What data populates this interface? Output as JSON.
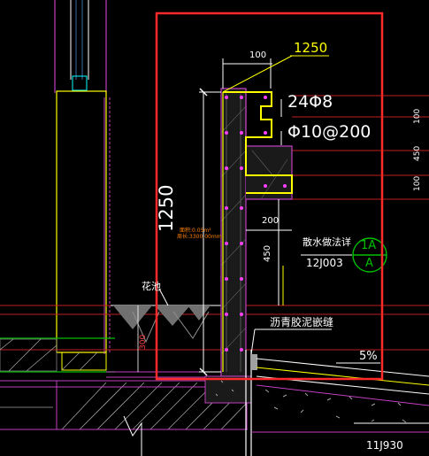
{
  "drawing": {
    "dim_top_width": "100",
    "dim_height_callout": "1250",
    "rebar_main": "24Φ8",
    "rebar_stirrup": "Φ10@200",
    "dim_vertical_1250": "1250",
    "dim_200": "200",
    "dim_450": "450",
    "dim_300": "300",
    "drain_ref_label": "散水做法详",
    "drain_ref_code": "12J003",
    "detail_bubble_top": "1A",
    "detail_bubble_bottom": "A",
    "planter_label": "花池",
    "joint_label": "沥青胶泥嵌缝",
    "slope_label": "5%",
    "std_ref": "11J930",
    "area_note_1": "面积:0.05m²",
    "area_note_2": "周长:3300.00mm",
    "right_dims": [
      "100",
      "450",
      "100"
    ]
  },
  "colors": {
    "background": "#000000",
    "highlight_red": "#ff2a2a",
    "rebar_yellow": "#ffff00",
    "wall_magenta": "#c040c0",
    "dim_white": "#ffffff",
    "green": "#00c000",
    "orange": "#ff8000"
  }
}
